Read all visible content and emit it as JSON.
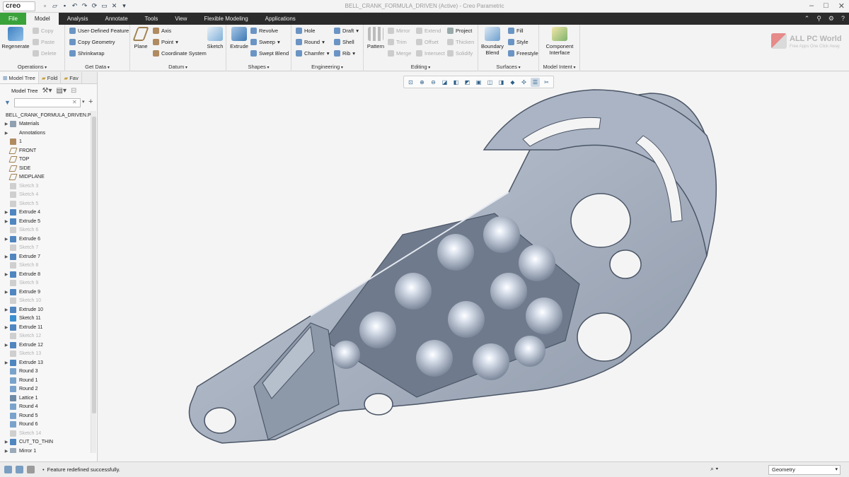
{
  "window": {
    "app_logo": "creo",
    "title": "BELL_CRANK_FORMULA_DRIVEN (Active) - Creo Parametric"
  },
  "tabs": [
    "File",
    "Model",
    "Analysis",
    "Annotate",
    "Tools",
    "View",
    "Flexible Modeling",
    "Applications"
  ],
  "ribbon": {
    "operations": {
      "label": "Operations",
      "regenerate": "Regenerate",
      "copy": "Copy",
      "paste": "Paste",
      "delete": "Delete"
    },
    "get_data": {
      "label": "Get Data",
      "udf": "User-Defined Feature",
      "copy_geometry": "Copy Geometry",
      "shrinkwrap": "Shrinkwrap"
    },
    "datum": {
      "label": "Datum",
      "plane": "Plane",
      "axis": "Axis",
      "point": "Point",
      "csys": "Coordinate System",
      "sketch": "Sketch"
    },
    "shapes": {
      "label": "Shapes",
      "extrude": "Extrude",
      "revolve": "Revolve",
      "sweep": "Sweep",
      "swept_blend": "Swept Blend"
    },
    "engineering": {
      "label": "Engineering",
      "hole": "Hole",
      "draft": "Draft",
      "round": "Round",
      "shell": "Shell",
      "chamfer": "Chamfer",
      "rib": "Rib"
    },
    "editing": {
      "label": "Editing",
      "pattern": "Pattern",
      "mirror": "Mirror",
      "extend": "Extend",
      "project": "Project",
      "trim": "Trim",
      "offset": "Offset",
      "thicken": "Thicken",
      "merge": "Merge",
      "intersect": "Intersect",
      "solidify": "Solidify"
    },
    "surfaces": {
      "label": "Surfaces",
      "boundary_blend_1": "Boundary",
      "boundary_blend_2": "Blend",
      "fill": "Fill",
      "style": "Style",
      "freestyle": "Freestyle"
    },
    "model_intent": {
      "label": "Model Intent",
      "ci_1": "Component",
      "ci_2": "Interface"
    }
  },
  "watermark": {
    "title": "ALL PC World",
    "subtitle": "Free Apps One Click Away"
  },
  "panel": {
    "tabs": [
      "Model Tree",
      "Fold",
      "Fav"
    ],
    "toolbar_label": "Model Tree",
    "tree": [
      {
        "label": "BELL_CRANK_FORMULA_DRIVEN.P",
        "expand": "",
        "icon": "part-icon",
        "dim": false
      },
      {
        "label": "Materials",
        "expand": "▶",
        "icon": "materials-icon",
        "dim": false
      },
      {
        "label": "Annotations",
        "expand": "▶",
        "icon": "",
        "dim": false
      },
      {
        "label": "1",
        "expand": "",
        "icon": "csys-icon",
        "dim": false
      },
      {
        "label": "FRONT",
        "expand": "",
        "icon": "plane-icon",
        "dim": false
      },
      {
        "label": "TOP",
        "expand": "",
        "icon": "plane-icon",
        "dim": false
      },
      {
        "label": "SIDE",
        "expand": "",
        "icon": "plane-icon",
        "dim": false
      },
      {
        "label": "MIDPLANE",
        "expand": "",
        "icon": "plane-icon",
        "dim": false
      },
      {
        "label": "Sketch 3",
        "expand": "",
        "icon": "sketch-icon",
        "dim": true
      },
      {
        "label": "Sketch 4",
        "expand": "",
        "icon": "sketch-icon",
        "dim": true
      },
      {
        "label": "Sketch 5",
        "expand": "",
        "icon": "sketch-icon",
        "dim": true
      },
      {
        "label": "Extrude 4",
        "expand": "▶",
        "icon": "extrude-icon",
        "dim": false
      },
      {
        "label": "Extrude 5",
        "expand": "▶",
        "icon": "extrude-icon",
        "dim": false
      },
      {
        "label": "Sketch 6",
        "expand": "",
        "icon": "sketch-icon",
        "dim": true
      },
      {
        "label": "Extrude 6",
        "expand": "▶",
        "icon": "extrude-icon",
        "dim": false
      },
      {
        "label": "Sketch 7",
        "expand": "",
        "icon": "sketch-icon",
        "dim": true
      },
      {
        "label": "Extrude 7",
        "expand": "▶",
        "icon": "extrude-icon",
        "dim": false
      },
      {
        "label": "Sketch 8",
        "expand": "",
        "icon": "sketch-icon",
        "dim": true
      },
      {
        "label": "Extrude 8",
        "expand": "▶",
        "icon": "extrude-icon",
        "dim": false
      },
      {
        "label": "Sketch 9",
        "expand": "",
        "icon": "sketch-icon",
        "dim": true
      },
      {
        "label": "Extrude 9",
        "expand": "▶",
        "icon": "extrude-icon",
        "dim": false
      },
      {
        "label": "Sketch 10",
        "expand": "",
        "icon": "sketch-icon",
        "dim": true
      },
      {
        "label": "Extrude 10",
        "expand": "▶",
        "icon": "extrude-icon",
        "dim": false
      },
      {
        "label": "Sketch 11",
        "expand": "",
        "icon": "sketch-active-icon",
        "dim": false
      },
      {
        "label": "Extrude 11",
        "expand": "▶",
        "icon": "extrude-icon",
        "dim": false
      },
      {
        "label": "Sketch 12",
        "expand": "",
        "icon": "sketch-icon",
        "dim": true
      },
      {
        "label": "Extrude 12",
        "expand": "▶",
        "icon": "extrude-icon",
        "dim": false
      },
      {
        "label": "Sketch 13",
        "expand": "",
        "icon": "sketch-icon",
        "dim": true
      },
      {
        "label": "Extrude 13",
        "expand": "▶",
        "icon": "extrude-icon",
        "dim": false
      },
      {
        "label": "Round 3",
        "expand": "",
        "icon": "round-icon",
        "dim": false
      },
      {
        "label": "Round 1",
        "expand": "",
        "icon": "round-icon",
        "dim": false
      },
      {
        "label": "Round 2",
        "expand": "",
        "icon": "round-icon",
        "dim": false
      },
      {
        "label": "Lattice 1",
        "expand": "",
        "icon": "lattice-icon",
        "dim": false
      },
      {
        "label": "Round 4",
        "expand": "",
        "icon": "round-icon",
        "dim": false
      },
      {
        "label": "Round 5",
        "expand": "",
        "icon": "round-icon",
        "dim": false
      },
      {
        "label": "Round 6",
        "expand": "",
        "icon": "round-icon",
        "dim": false
      },
      {
        "label": "Sketch 14",
        "expand": "",
        "icon": "sketch-icon",
        "dim": true
      },
      {
        "label": "CUT_TO_THIN",
        "expand": "▶",
        "icon": "cut-icon",
        "dim": false
      },
      {
        "label": "Mirror 1",
        "expand": "▶",
        "icon": "mirror-icon",
        "dim": false
      }
    ]
  },
  "status": {
    "message": "Feature redefined successfully.",
    "filter_value": "Geometry"
  },
  "colors": {
    "file_tab": "#3aa23a",
    "tabbar": "#2b2b2b",
    "part_fill": "#a5b0c0",
    "part_edge": "#4a5566"
  }
}
